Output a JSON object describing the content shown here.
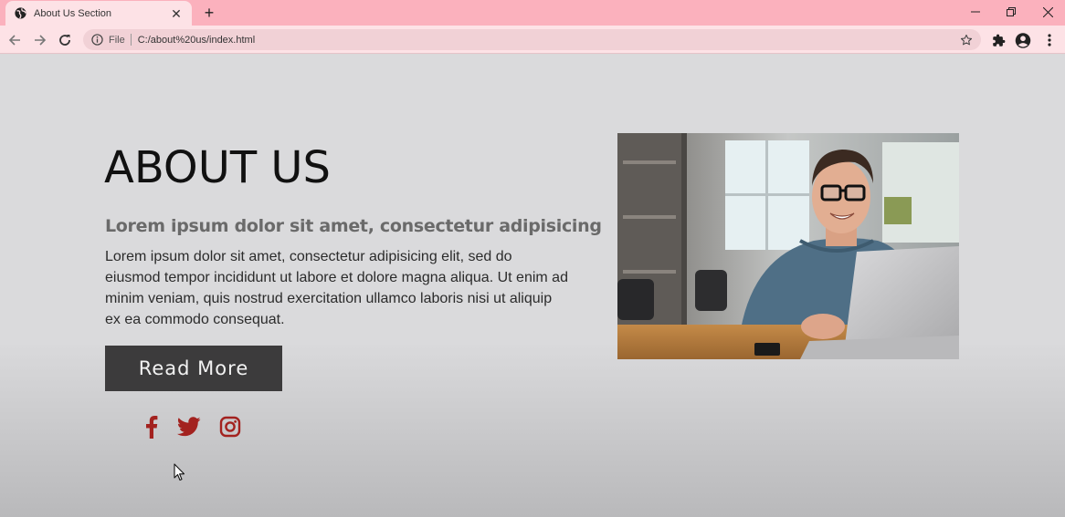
{
  "browser": {
    "tab_title": "About Us Section",
    "omnibox": {
      "scheme_label": "File",
      "url": "C:/about%20us/index.html"
    }
  },
  "page": {
    "heading": "ABOUT US",
    "subheading": "Lorem ipsum dolor sit amet, consectetur adipisicing",
    "body": "Lorem ipsum dolor sit amet, consectetur adipisicing elit, sed do eiusmod tempor incididunt ut labore et dolore magna aliqua. Ut enim ad minim veniam, quis nostrud exercitation ullamco laboris nisi ut aliquip ex ea commodo consequat.",
    "read_more_label": "Read More",
    "social_icons": [
      "facebook-icon",
      "twitter-icon",
      "instagram-icon"
    ],
    "accent_color": "#a3221f",
    "button_color": "#3c3b3c"
  }
}
